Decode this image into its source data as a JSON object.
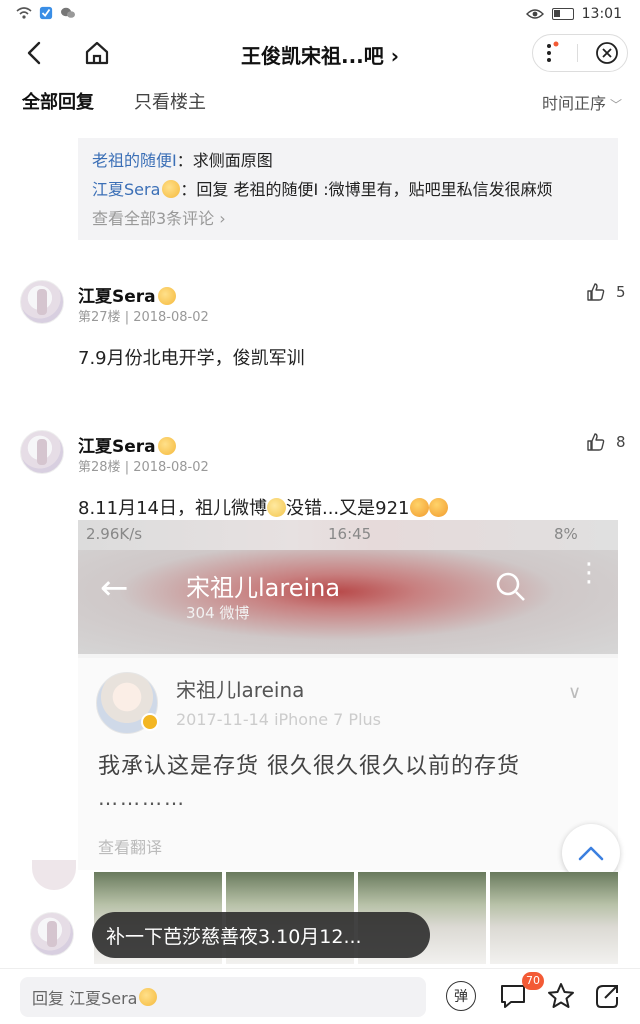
{
  "status_bar": {
    "time": "13:01"
  },
  "nav": {
    "title": "王俊凯宋祖...吧",
    "title_chevron": "›"
  },
  "tabs": {
    "all_replies": "全部回复",
    "only_op": "只看楼主",
    "sort": "时间正序"
  },
  "sub_replies": {
    "lines": [
      {
        "user": "老祖的随便I",
        "text": "：求侧面原图"
      },
      {
        "user": "江夏Sera",
        "text": "：回复 老祖的随便I :微博里有，贴吧里私信发很麻烦"
      }
    ],
    "more": "查看全部3条评论 ›"
  },
  "posts": [
    {
      "username": "江夏Sera",
      "floor": "第27楼",
      "sep": "|",
      "date": "2018-08-02",
      "likes": "5",
      "text": "7.9月份北电开学，俊凯军训"
    },
    {
      "username": "江夏Sera",
      "floor": "第28楼",
      "sep": "|",
      "date": "2018-08-02",
      "likes": "8",
      "text_a": "8.11月14日，祖儿微博",
      "text_b": "没错...又是921"
    }
  ],
  "screenshot": {
    "status_left": "2.96K/s",
    "status_time": "16:45",
    "status_battery": "8%",
    "header_name": "宋祖儿lareina",
    "header_count": "304 微博",
    "post_user": "宋祖儿lareina",
    "post_meta": "2017-11-14  iPhone 7 Plus",
    "post_text": "我承认这是存货 很久很久很久以前的存货",
    "post_dots": "…………",
    "translate": "查看翻译"
  },
  "toast": {
    "text": "补一下芭莎慈善夜3.10月12..."
  },
  "bottom": {
    "reply_placeholder": "回复 江夏Sera",
    "danmu": "弹",
    "comment_badge": "70"
  },
  "colors": {
    "link_blue": "#3b6fb6",
    "badge_red": "#f35a35",
    "scroll_top_blue": "#3b7fe0"
  }
}
